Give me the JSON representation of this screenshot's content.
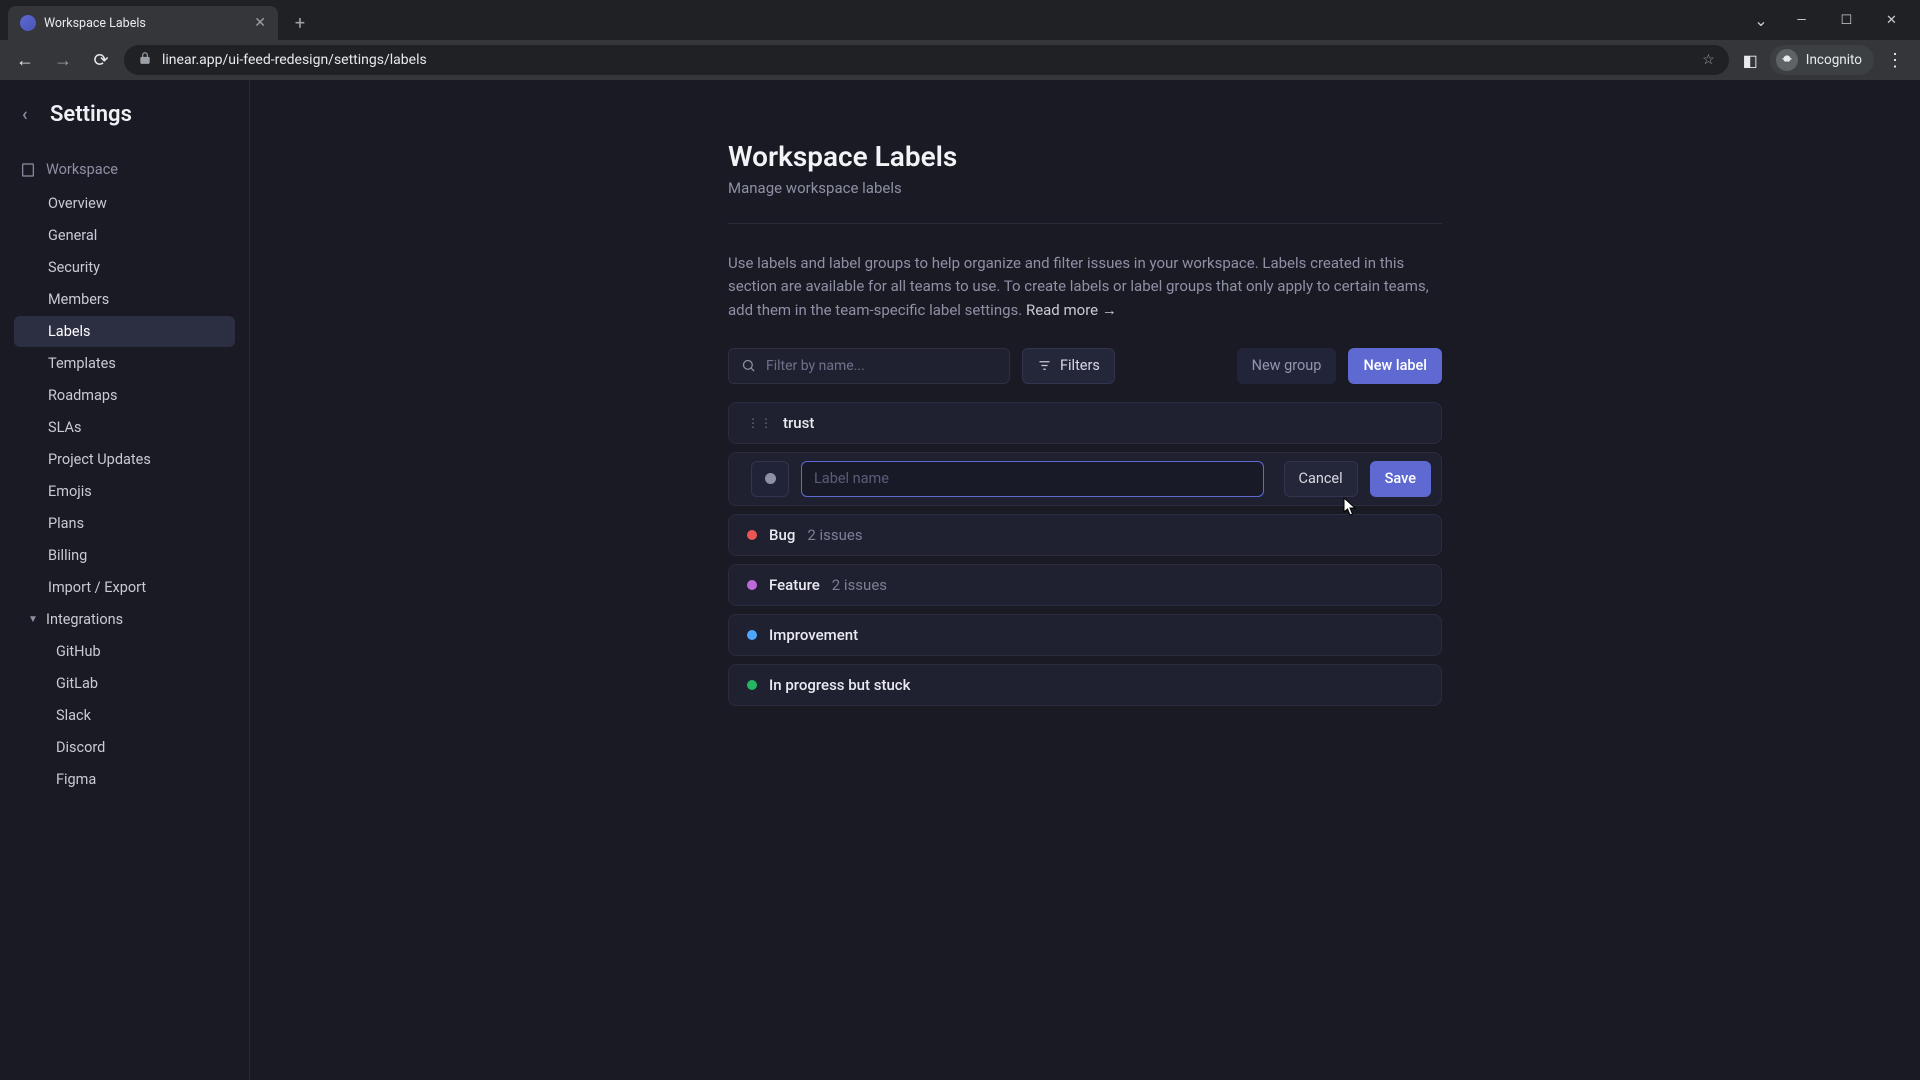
{
  "browser": {
    "tab_title": "Workspace Labels",
    "url_display": "linear.app/ui-feed-redesign/settings/labels",
    "incognito_label": "Incognito"
  },
  "sidebar": {
    "header": "Settings",
    "workspace_label": "Workspace",
    "items": [
      {
        "label": "Overview"
      },
      {
        "label": "General"
      },
      {
        "label": "Security"
      },
      {
        "label": "Members"
      },
      {
        "label": "Labels"
      },
      {
        "label": "Templates"
      },
      {
        "label": "Roadmaps"
      },
      {
        "label": "SLAs"
      },
      {
        "label": "Project Updates"
      },
      {
        "label": "Emojis"
      },
      {
        "label": "Plans"
      },
      {
        "label": "Billing"
      },
      {
        "label": "Import / Export"
      }
    ],
    "integrations_label": "Integrations",
    "integrations": [
      {
        "label": "GitHub"
      },
      {
        "label": "GitLab"
      },
      {
        "label": "Slack"
      },
      {
        "label": "Discord"
      },
      {
        "label": "Figma"
      }
    ]
  },
  "page": {
    "title": "Workspace Labels",
    "subtitle": "Manage workspace labels",
    "description": "Use labels and label groups to help organize and filter issues in your workspace. Labels created in this section are available for all teams to use. To create labels or label groups that only apply to certain teams, add them in the team-specific label settings. ",
    "read_more": "Read more →",
    "filter_placeholder": "Filter by name...",
    "filters_btn": "Filters",
    "new_group_btn": "New group",
    "new_label_btn": "New label"
  },
  "group": {
    "name": "trust"
  },
  "editor": {
    "placeholder": "Label name",
    "value": "",
    "cancel": "Cancel",
    "save": "Save",
    "swatch_color": "#8e90a5"
  },
  "labels": [
    {
      "name": "Bug",
      "count": "2 issues",
      "color": "#eb5757"
    },
    {
      "name": "Feature",
      "count": "2 issues",
      "color": "#bb6bd9"
    },
    {
      "name": "Improvement",
      "count": "",
      "color": "#4ea7fc"
    },
    {
      "name": "In progress but stuck",
      "count": "",
      "color": "#26b562"
    }
  ]
}
